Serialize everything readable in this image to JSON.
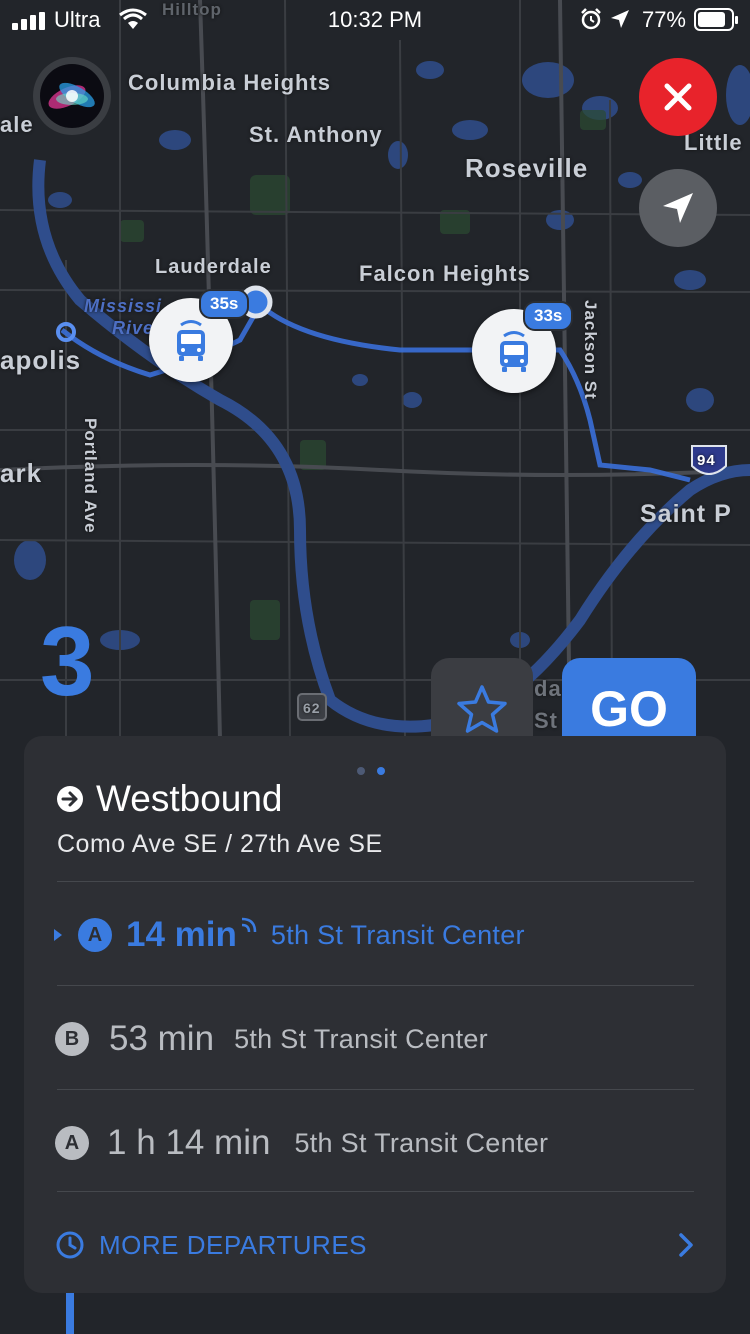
{
  "status_bar": {
    "carrier": "Ultra",
    "time": "10:32 PM",
    "battery": "77%"
  },
  "map": {
    "labels": {
      "columbia_heights": "Columbia Heights",
      "st_anthony": "St. Anthony",
      "roseville": "Roseville",
      "little": "Little",
      "lauderdale": "Lauderdale",
      "falcon_heights": "Falcon Heights",
      "jackson_st": "Jackson St",
      "mississippi": "Mississi",
      "river": "Rive",
      "apolis": "apolis",
      "ale": "ale",
      "ark": "ark",
      "portland_ave": "Portland Ave",
      "saint_p": "Saint P",
      "hwy94": "94",
      "hwy62": "62",
      "hilltop": "Hilltop",
      "partial_da": "da",
      "partial_st": "St"
    },
    "buses": [
      {
        "badge": "35s"
      },
      {
        "badge": "33s"
      }
    ]
  },
  "route": {
    "number": "3",
    "go_label": "GO"
  },
  "card": {
    "direction": "Westbound",
    "stop": "Como Ave SE / 27th Ave SE",
    "departures": [
      {
        "badge": "A",
        "time": "14 min",
        "destination": "5th St Transit Center",
        "live": true
      },
      {
        "badge": "B",
        "time": "53 min",
        "destination": "5th St Transit Center",
        "live": false
      },
      {
        "badge": "A",
        "time": "1 h 14 min",
        "destination": "5th St Transit Center",
        "live": false
      }
    ],
    "more_label": "MORE DEPARTURES"
  },
  "colors": {
    "accent": "#3a7be0",
    "close": "#e8232b",
    "background": "#23262b",
    "card": "#2d2f34",
    "muted_text": "#b9bcc1"
  }
}
